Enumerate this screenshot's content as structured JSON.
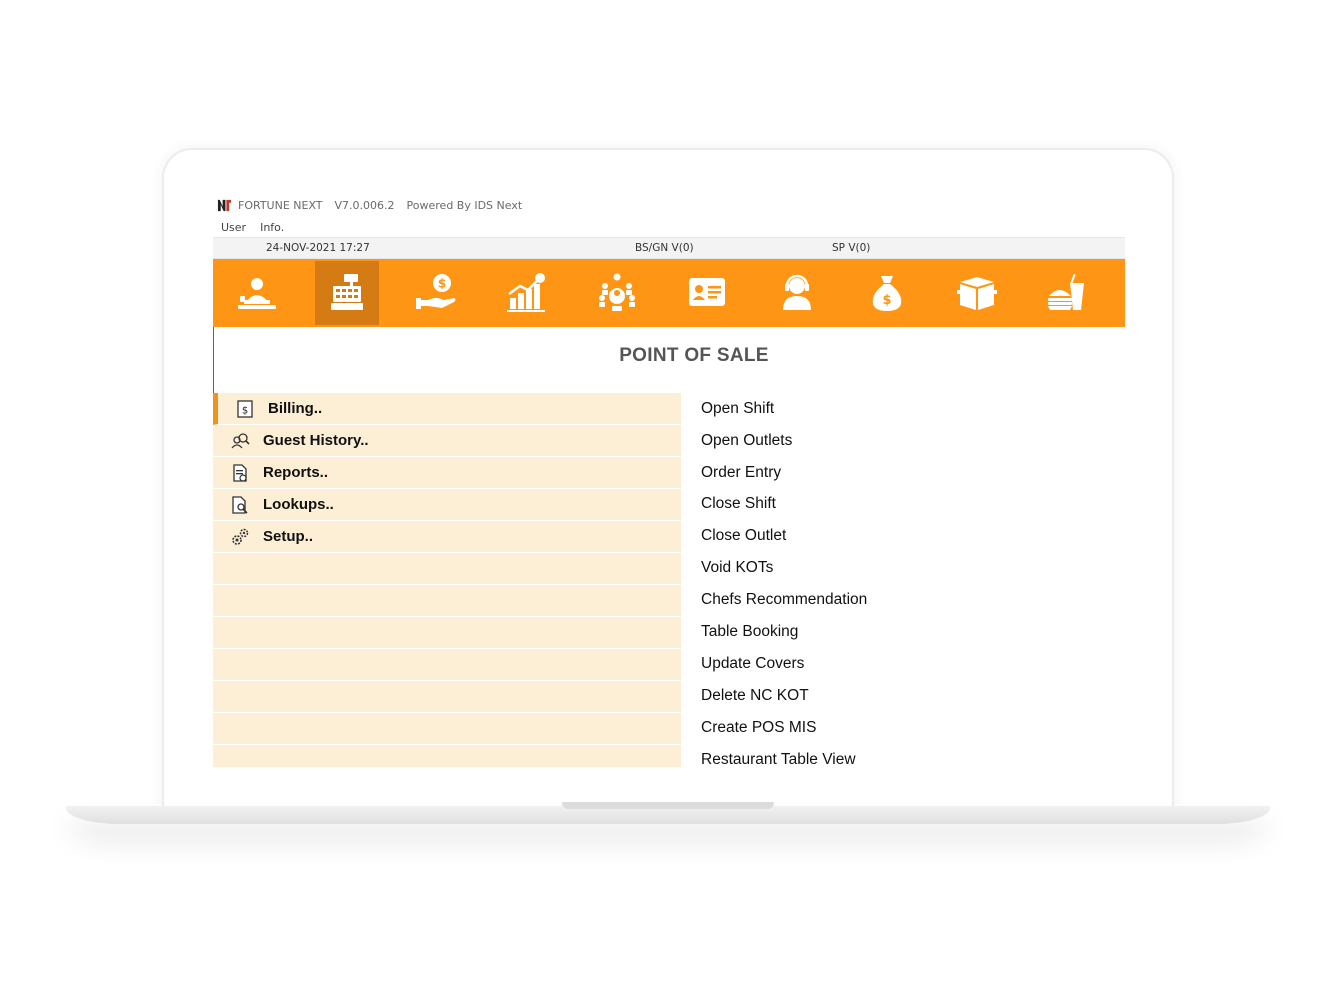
{
  "titlebar": {
    "app_name": "FORTUNE NEXT",
    "version": "V7.0.006.2",
    "powered_by": "Powered By IDS Next"
  },
  "menubar": {
    "items": [
      "User",
      "Info."
    ]
  },
  "statusbar": {
    "datetime": "24-NOV-2021 17:27",
    "bs_gn": "BS/GN V(0)",
    "sp": "SP V(0)"
  },
  "toolbar": {
    "active_index": 1,
    "icons": [
      "front-desk-icon",
      "cash-register-icon",
      "payment-hand-icon",
      "growth-chart-icon",
      "conference-icon",
      "id-card-icon",
      "support-agent-icon",
      "money-bag-icon",
      "inventory-box-icon",
      "food-beverage-icon"
    ],
    "colors": {
      "bar": "#ff9514",
      "active": "#d57b14",
      "icon": "#ffffff"
    }
  },
  "page": {
    "title": "POINT OF SALE"
  },
  "menu": {
    "items": [
      {
        "label": "Billing..",
        "icon": "dollar-document-icon"
      },
      {
        "label": "Guest History..",
        "icon": "guest-search-icon"
      },
      {
        "label": "Reports..",
        "icon": "report-icon"
      },
      {
        "label": "Lookups..",
        "icon": "lookup-icon"
      },
      {
        "label": "Setup..",
        "icon": "gears-icon"
      }
    ],
    "panel_color": "#fdefd6",
    "accent_color": "#f0921e"
  },
  "actions": [
    "Open Shift",
    "Open Outlets",
    "Order Entry",
    "Close Shift",
    "Close Outlet",
    "Void KOTs",
    "Chefs Recommendation",
    "Table Booking",
    "Update Covers",
    "Delete NC KOT",
    "Create POS MIS",
    "Restaurant Table View"
  ]
}
